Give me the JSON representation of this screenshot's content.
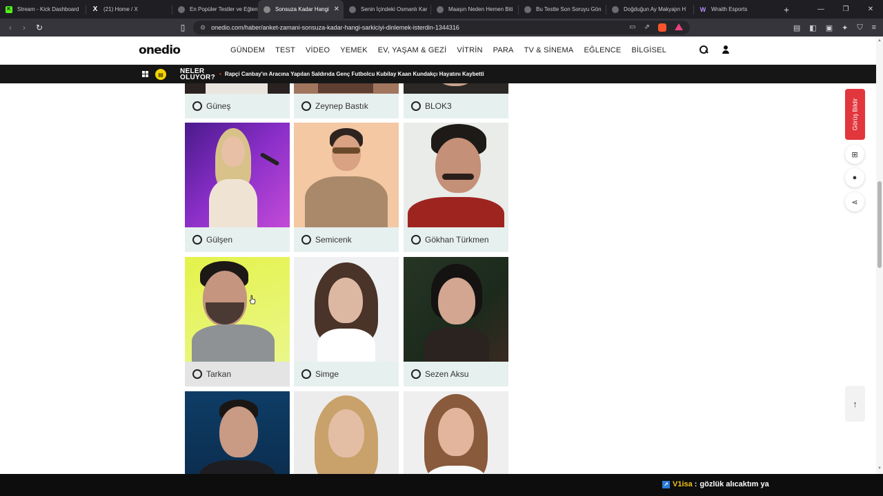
{
  "browser": {
    "tabs": [
      {
        "title": "Stream - Kick Dashboard",
        "icon": "kick-icon"
      },
      {
        "title": "(21) Home / X",
        "icon": "x-icon"
      },
      {
        "title": "En Popüler Testler ve Eğlen",
        "icon": "onedio-icon"
      },
      {
        "title": "Sonsuza Kadar Hangi",
        "icon": "onedio-icon",
        "active": true
      },
      {
        "title": "Senin İçindeki Osmanlı Kar",
        "icon": "onedio-icon"
      },
      {
        "title": "Maaşın Neden Hemen Biti",
        "icon": "onedio-icon"
      },
      {
        "title": "Bu Testte Son Soruyu Gön",
        "icon": "onedio-icon"
      },
      {
        "title": "Doğduğun Ay Makyajın H",
        "icon": "onedio-icon"
      },
      {
        "title": "Wraith Esports",
        "icon": "wraith-icon"
      }
    ],
    "new_tab": "+",
    "url": "onedio.com/haber/anket-zamani-sonsuza-kadar-hangi-sarkiciyi-dinlemek-isterdin-1344316"
  },
  "site": {
    "logo": "onedio",
    "nav": [
      "GÜNDEM",
      "TEST",
      "VİDEO",
      "YEMEK",
      "EV, YAŞAM & GEZİ",
      "VİTRİN",
      "PARA",
      "TV & SİNEMA",
      "EĞLENCE",
      "BİLGİSEL"
    ]
  },
  "ticker": {
    "label_line1": "NELER",
    "label_line2": "OLUYOR?",
    "headline": "Rapçi Canbay'ın Aracına Yapılan Saldırıda Genç Futbolcu Kubilay Kaan Kundakçı Hayatını Kaybetti"
  },
  "poll": {
    "options_top": [
      "Güneş",
      "Zeynep Bastık",
      "BLOK3"
    ],
    "options_row2": [
      "Gülşen",
      "Semicenk",
      "Gökhan Türkmen"
    ],
    "options_row3": [
      "Tarkan",
      "Simge",
      "Sezen Aksu"
    ]
  },
  "sidebar": {
    "feedback_label": "Görüş Bildir",
    "totop_label": "↑"
  },
  "chat": {
    "username": "V1isa",
    "separator": ":",
    "message": "gözlük alıcaktım ya"
  },
  "colors": {
    "accent_red": "#e2363d",
    "option_bg": "#e6f0ee",
    "ticker_bg": "#161616",
    "chat_username": "#f0c21a"
  }
}
